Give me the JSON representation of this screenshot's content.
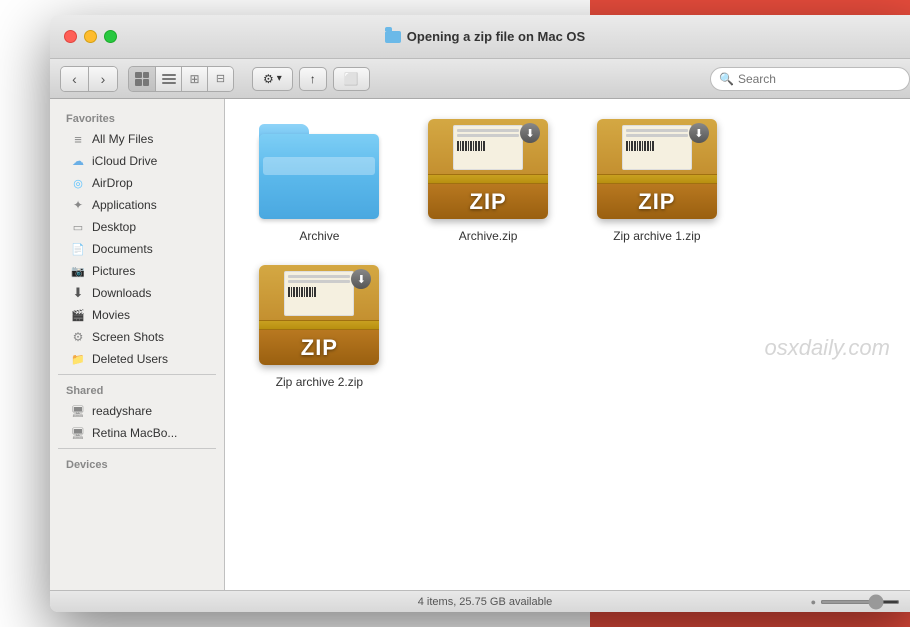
{
  "window": {
    "title": "Opening a zip file on Mac OS",
    "title_folder_label": "Folder"
  },
  "toolbar": {
    "search_placeholder": "Search"
  },
  "sidebar": {
    "favorites_label": "Favorites",
    "shared_label": "Shared",
    "devices_label": "Devices",
    "items": [
      {
        "id": "all-my-files",
        "label": "All My Files",
        "icon": "list-icon"
      },
      {
        "id": "icloud-drive",
        "label": "iCloud Drive",
        "icon": "cloud-icon"
      },
      {
        "id": "airdrop",
        "label": "AirDrop",
        "icon": "airdrop-icon"
      },
      {
        "id": "applications",
        "label": "Applications",
        "icon": "apps-icon"
      },
      {
        "id": "desktop",
        "label": "Desktop",
        "icon": "desktop-icon"
      },
      {
        "id": "documents",
        "label": "Documents",
        "icon": "docs-icon"
      },
      {
        "id": "pictures",
        "label": "Pictures",
        "icon": "pics-icon"
      },
      {
        "id": "downloads",
        "label": "Downloads",
        "icon": "downloads-icon"
      },
      {
        "id": "movies",
        "label": "Movies",
        "icon": "movies-icon"
      },
      {
        "id": "screenshots",
        "label": "Screen Shots",
        "icon": "gear-icon"
      },
      {
        "id": "deleted-users",
        "label": "Deleted Users",
        "icon": "folder-icon"
      }
    ],
    "shared_items": [
      {
        "id": "readyshare",
        "label": "readyshare",
        "icon": "monitor-icon"
      },
      {
        "id": "retina-mac",
        "label": "Retina MacBo...",
        "icon": "monitor-icon"
      }
    ]
  },
  "files": [
    {
      "name": "Archive",
      "type": "folder"
    },
    {
      "name": "Archive.zip",
      "type": "zip"
    },
    {
      "name": "Zip archive 1.zip",
      "type": "zip"
    },
    {
      "name": "Zip archive 2.zip",
      "type": "zip"
    }
  ],
  "status": {
    "text": "4 items, 25.75 GB available"
  },
  "watermark": "osxdaily.com"
}
